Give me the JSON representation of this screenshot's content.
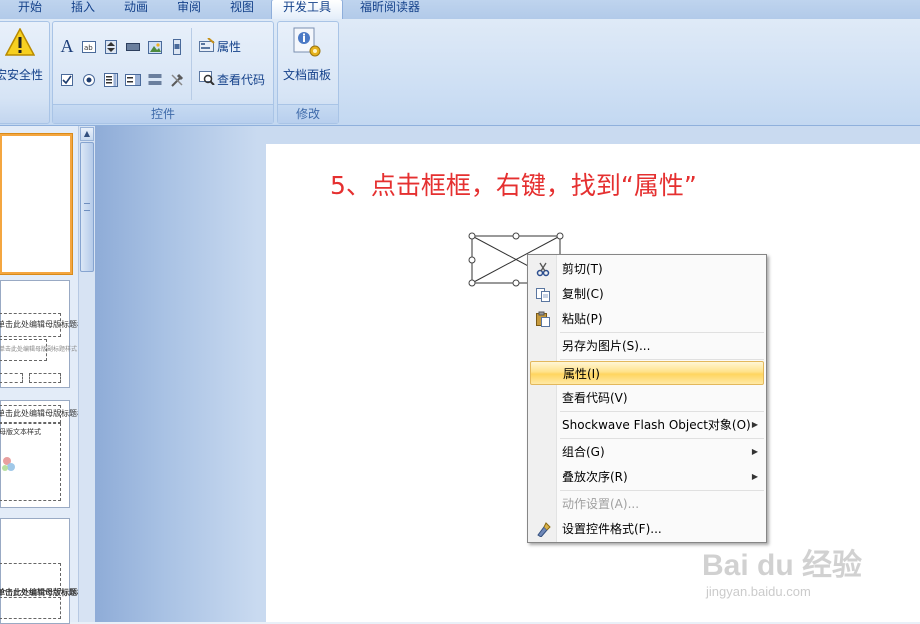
{
  "tabs": [
    {
      "label": "开始",
      "active": false
    },
    {
      "label": "插入",
      "active": false
    },
    {
      "label": "动画",
      "active": false
    },
    {
      "label": "审阅",
      "active": false
    },
    {
      "label": "视图",
      "active": false
    },
    {
      "label": "开发工具",
      "active": true
    },
    {
      "label": "福昕阅读器",
      "active": false
    }
  ],
  "ribbon": {
    "security_label": "宏安全性",
    "controls_group_label": "控件",
    "properties_label": "属性",
    "view_code_label": "查看代码",
    "doc_panel_label": "文档面板",
    "modify_group_label": "修改"
  },
  "thumbnails": {
    "slide2_title": "单击此处编辑母版标题样式",
    "slide2_sub": "单击此处编辑母版副标题样式",
    "slide3_title": "单击此处编辑母版标题样式",
    "slide3_sub": "母版文本样式",
    "slide4_title": "单击此处编辑母版标题样式"
  },
  "slide": {
    "instruction": "5、点击框框，右键，找到“属性”"
  },
  "context_menu": {
    "items": [
      {
        "label": "剪切(T)",
        "icon": "scissors-icon"
      },
      {
        "label": "复制(C)",
        "icon": "copy-icon"
      },
      {
        "label": "粘贴(P)",
        "icon": "paste-icon"
      },
      {
        "label": "另存为图片(S)..."
      },
      {
        "label": "属性(I)",
        "highlighted": true
      },
      {
        "label": "查看代码(V)"
      },
      {
        "label": "Shockwave Flash Object对象(O)",
        "submenu": true
      },
      {
        "label": "组合(G)",
        "submenu": true
      },
      {
        "label": "叠放次序(R)",
        "submenu": true
      },
      {
        "label": "动作设置(A)...",
        "disabled": true
      },
      {
        "label": "设置控件格式(F)...",
        "icon": "format-control-icon"
      }
    ]
  },
  "watermark": {
    "brand": "Bai du 经验",
    "url": "jingyan.baidu.com"
  },
  "colors": {
    "instruction_text": "#e53030",
    "menu_highlight": "#ffd55f",
    "ribbon_text": "#15428b"
  }
}
